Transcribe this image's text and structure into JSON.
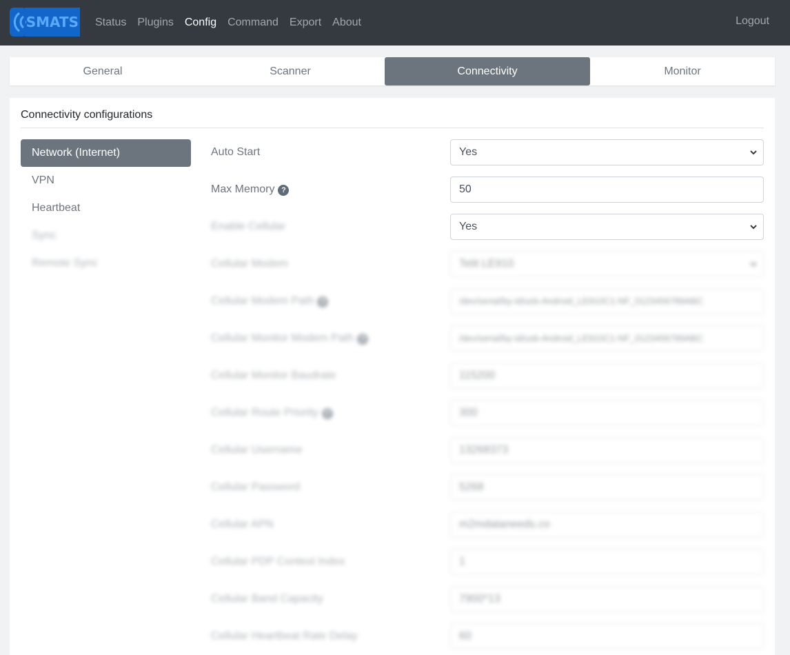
{
  "nav": {
    "brand": "SMATS",
    "links": [
      "Status",
      "Plugins",
      "Config",
      "Command",
      "Export",
      "About"
    ],
    "active": "Config",
    "logout": "Logout"
  },
  "tabs": [
    "General",
    "Scanner",
    "Connectivity",
    "Monitor"
  ],
  "active_tab": "Connectivity",
  "card": {
    "title": "Connectivity configurations"
  },
  "side_menu": {
    "items": [
      "Network (Internet)",
      "VPN",
      "Heartbeat",
      "Sync",
      "Remote Sync"
    ],
    "active": "Network (Internet)"
  },
  "form": {
    "rows": [
      {
        "label": "Auto Start",
        "value": "Yes",
        "type": "select"
      },
      {
        "label": "Max Memory",
        "value": "50",
        "type": "input",
        "help": true
      },
      {
        "label": "Enable Cellular",
        "value": "Yes",
        "type": "select"
      },
      {
        "label": "Cellular Modem",
        "value": "Telit LE910",
        "type": "select"
      },
      {
        "label": "Cellular Modem Path",
        "value": "/dev/serial/by-id/usb-Android_LE910C1-NF_0123456789ABC",
        "type": "input",
        "help": true
      },
      {
        "label": "Cellular Monitor Modem Path",
        "value": "/dev/serial/by-id/usb-Android_LE910C1-NF_0123456789ABC",
        "type": "input",
        "help": true
      },
      {
        "label": "Cellular Monitor Baudrate",
        "value": "115200",
        "type": "input"
      },
      {
        "label": "Cellular Route Priority",
        "value": "300",
        "type": "input",
        "help": true
      },
      {
        "label": "Cellular Username",
        "value": "13268373",
        "type": "input"
      },
      {
        "label": "Cellular Password",
        "value": "5268",
        "type": "input"
      },
      {
        "label": "Cellular APN",
        "value": "m2mdataneeds.co",
        "type": "input"
      },
      {
        "label": "Cellular PDP Context Index",
        "value": "1",
        "type": "input"
      },
      {
        "label": "Cellular Band Capacity",
        "value": "7900*13",
        "type": "input"
      },
      {
        "label": "Cellular Heartbeat Rate Delay",
        "value": "60",
        "type": "input"
      }
    ]
  },
  "colors": {
    "navbar": "#343a40",
    "active_tab": "#6c757d",
    "brand": "#1366c9"
  }
}
